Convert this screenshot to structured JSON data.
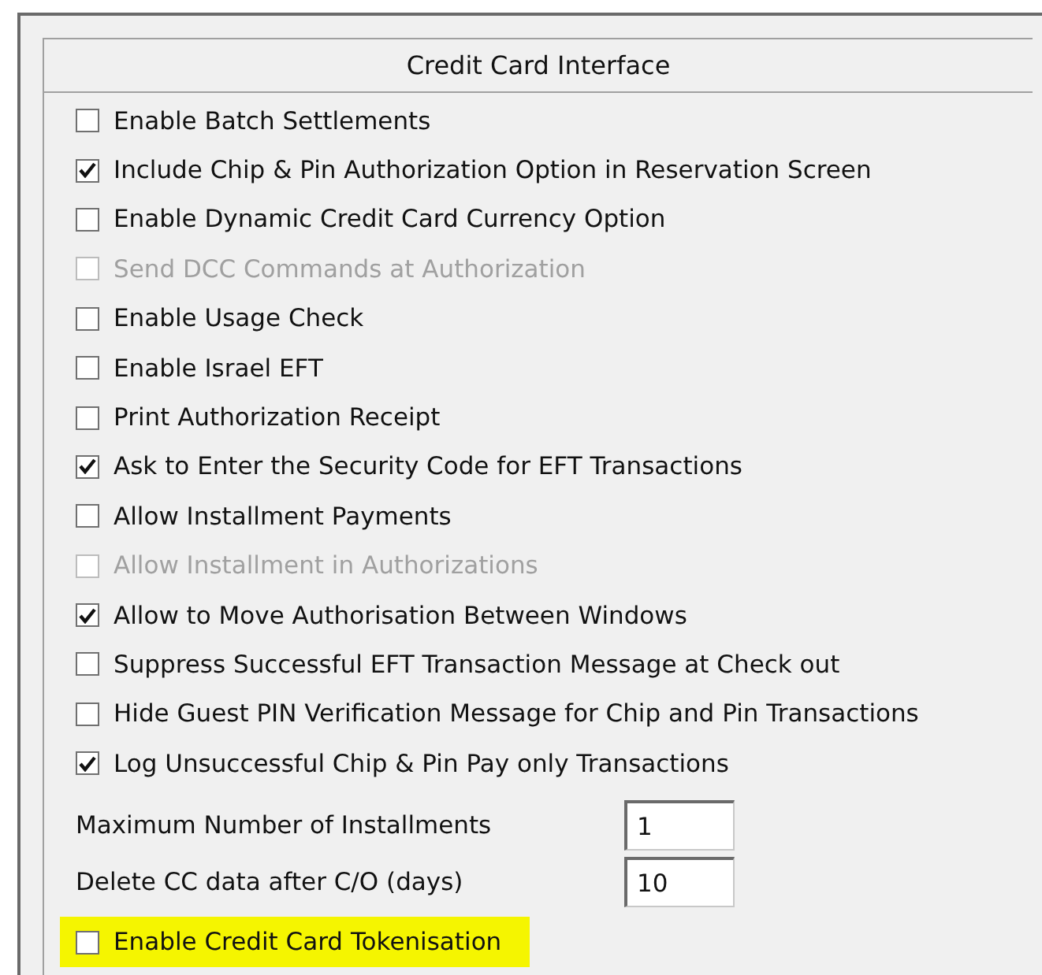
{
  "panel": {
    "title": "Credit Card Interface"
  },
  "options": [
    {
      "label": "Enable Batch Settlements",
      "checked": false,
      "disabled": false
    },
    {
      "label": "Include Chip & Pin Authorization Option in Reservation Screen",
      "checked": true,
      "disabled": false
    },
    {
      "label": "Enable Dynamic Credit Card Currency Option",
      "checked": false,
      "disabled": false
    },
    {
      "label": "Send DCC Commands at Authorization",
      "checked": false,
      "disabled": true
    },
    {
      "label": "Enable Usage Check",
      "checked": false,
      "disabled": false
    },
    {
      "label": "Enable Israel EFT",
      "checked": false,
      "disabled": false
    },
    {
      "label": "Print Authorization Receipt",
      "checked": false,
      "disabled": false
    },
    {
      "label": "Ask to Enter the Security Code for EFT Transactions",
      "checked": true,
      "disabled": false
    },
    {
      "label": "Allow Installment Payments",
      "checked": false,
      "disabled": false
    },
    {
      "label": "Allow Installment in Authorizations",
      "checked": false,
      "disabled": true
    },
    {
      "label": "Allow to Move Authorisation Between Windows",
      "checked": true,
      "disabled": false
    },
    {
      "label": "Suppress Successful EFT Transaction Message at Check out",
      "checked": false,
      "disabled": false
    },
    {
      "label": "Hide Guest PIN Verification Message for Chip and Pin Transactions",
      "checked": false,
      "disabled": false
    },
    {
      "label": "Log Unsuccessful Chip & Pin Pay only Transactions",
      "checked": true,
      "disabled": false
    }
  ],
  "fields": [
    {
      "label": "Maximum Number of Installments",
      "value": "1"
    },
    {
      "label": "Delete CC data after C/O (days)",
      "value": "10"
    }
  ],
  "final_option": {
    "label": "Enable Credit Card Tokenisation",
    "checked": false,
    "highlighted": true
  }
}
